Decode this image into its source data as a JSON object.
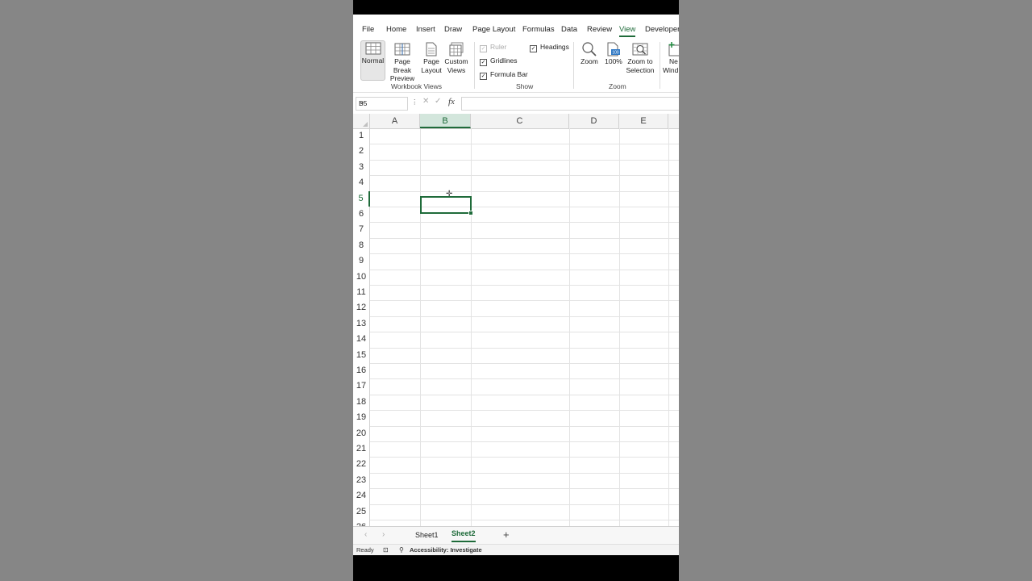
{
  "ribbon_tabs": [
    "File",
    "Home",
    "Insert",
    "Draw",
    "Page Layout",
    "Formulas",
    "Data",
    "Review",
    "View",
    "Developer"
  ],
  "active_tab": "View",
  "workbook_views": {
    "normal": "Normal",
    "page_break_preview": [
      "Page Break",
      "Preview"
    ],
    "page_layout": [
      "Page",
      "Layout"
    ],
    "custom_views": [
      "Custom",
      "Views"
    ],
    "group_label": "Workbook Views"
  },
  "show": {
    "ruler": "Ruler",
    "gridlines": "Gridlines",
    "formula_bar": "Formula Bar",
    "headings": "Headings",
    "group_label": "Show",
    "ruler_checked": true,
    "gridlines_checked": true,
    "formula_bar_checked": true,
    "headings_checked": true
  },
  "zoom": {
    "zoom": "Zoom",
    "hundred": "100%",
    "zoom_to_selection": [
      "Zoom to",
      "Selection"
    ],
    "group_label": "Zoom"
  },
  "window": {
    "new_window": [
      "Ne",
      "Wind"
    ]
  },
  "formula_bar": {
    "name_box": "B5",
    "fx": "fx",
    "value": ""
  },
  "columns": [
    "A",
    "B",
    "C",
    "D",
    "E"
  ],
  "rows": [
    "1",
    "2",
    "3",
    "4",
    "5",
    "6",
    "7",
    "8",
    "9",
    "10",
    "11",
    "12",
    "13",
    "14",
    "15",
    "16",
    "17",
    "18",
    "19",
    "20",
    "21",
    "22",
    "23",
    "24",
    "25",
    "26"
  ],
  "selected_cell": "B5",
  "sheets": [
    "Sheet1",
    "Sheet2"
  ],
  "active_sheet": "Sheet2",
  "add_sheet": "+",
  "status": {
    "ready": "Ready",
    "accessibility": "Accessibility: Investigate"
  },
  "colors": {
    "accent": "#1f6b3a",
    "backdrop": "#868686"
  }
}
